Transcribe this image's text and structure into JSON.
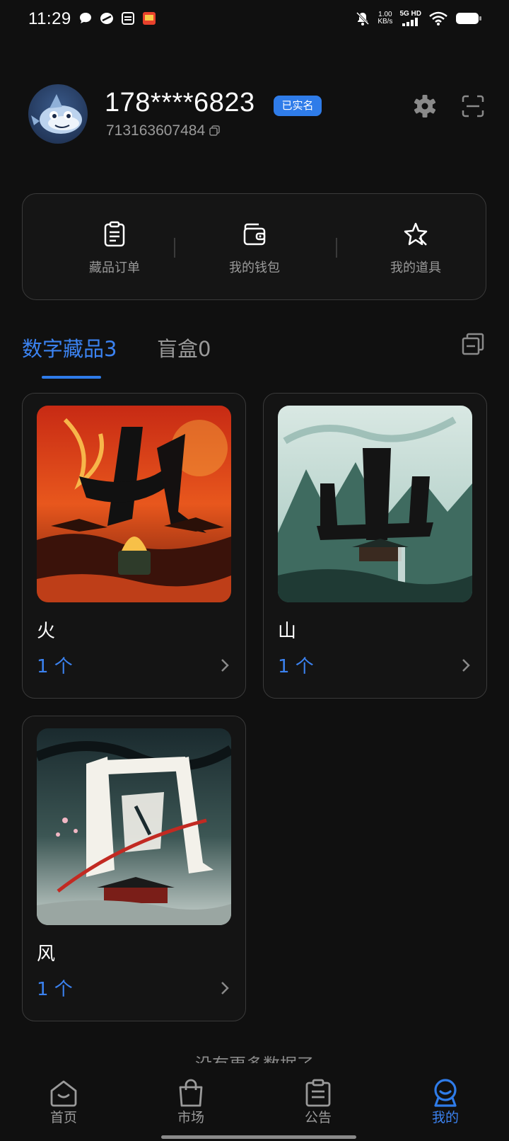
{
  "status_bar": {
    "time": "11:29",
    "net_speed": "1.00",
    "net_unit": "KB/s",
    "network": "5G HD",
    "icons": [
      "chat-bubble-icon",
      "app-icon",
      "sim-icon",
      "notification-app-icon",
      "mute-icon",
      "signal-icon",
      "wifi-icon",
      "battery-icon"
    ]
  },
  "profile": {
    "username": "178****6823",
    "verified_label": "已实名",
    "user_id": "713163607484"
  },
  "quick_menu": [
    {
      "label": "藏品订单",
      "icon": "order-list-icon"
    },
    {
      "label": "我的钱包",
      "icon": "wallet-icon"
    },
    {
      "label": "我的道具",
      "icon": "star-tool-icon"
    }
  ],
  "tabs": {
    "active": "数字藏品3",
    "inactive": "盲盒0"
  },
  "collections": [
    {
      "title": "火",
      "count": "1 个"
    },
    {
      "title": "山",
      "count": "1 个"
    },
    {
      "title": "风",
      "count": "1 个"
    }
  ],
  "footer_text": "没有更多数据了",
  "bottom_nav": [
    {
      "label": "首页",
      "icon": "home-icon"
    },
    {
      "label": "市场",
      "icon": "shopping-bag-icon"
    },
    {
      "label": "公告",
      "icon": "announcement-icon"
    },
    {
      "label": "我的",
      "icon": "profile-icon"
    }
  ],
  "colors": {
    "accent": "#2f7ce9",
    "background": "#101010",
    "card_border": "#3a3a3a"
  }
}
